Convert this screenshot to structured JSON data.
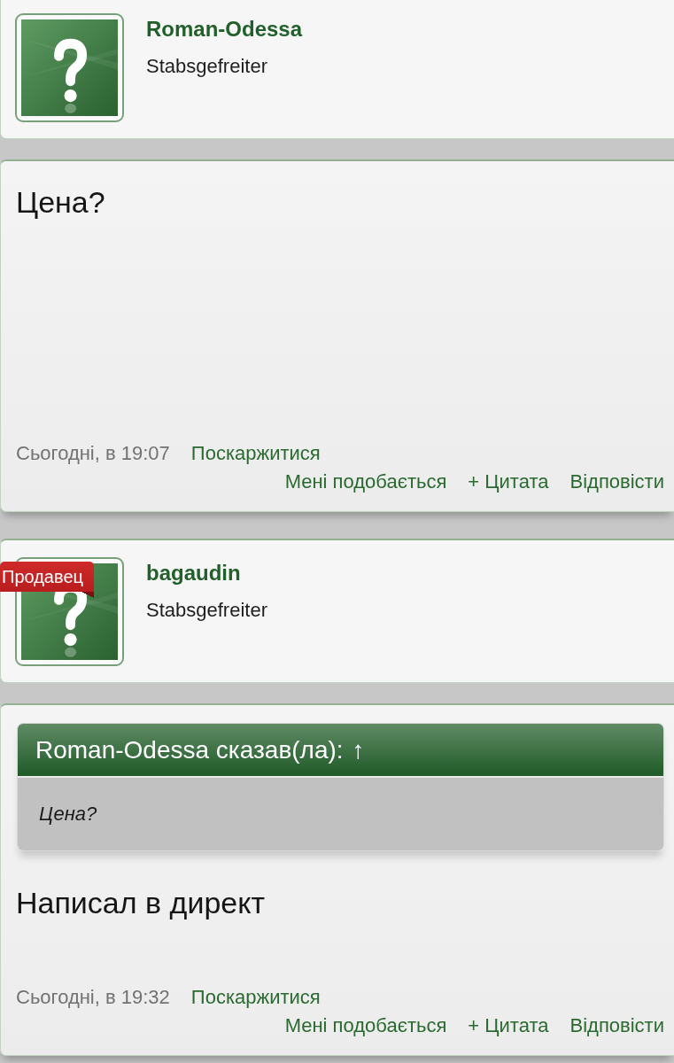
{
  "posts": [
    {
      "author": {
        "name": "Roman-Odessa",
        "rank": "Stabsgefreiter"
      },
      "text": "Цена?",
      "time": "Сьогодні, в 19:07",
      "report": "Поскаржитися",
      "actions": [
        "Мені подобається",
        "+ Цитата",
        "Відповісти"
      ]
    },
    {
      "author": {
        "name": "bagaudin",
        "rank": "Stabsgefreiter",
        "badge": "Продавец"
      },
      "quote": {
        "attribution": "Roman-Odessa сказав(ла):",
        "link": "↑",
        "text": "Цена?"
      },
      "text": "Написал в директ",
      "time": "Сьогодні, в 19:32",
      "report": "Поскаржитися",
      "actions": [
        "Мені подобається",
        "+ Цитата",
        "Відповісти"
      ]
    }
  ]
}
